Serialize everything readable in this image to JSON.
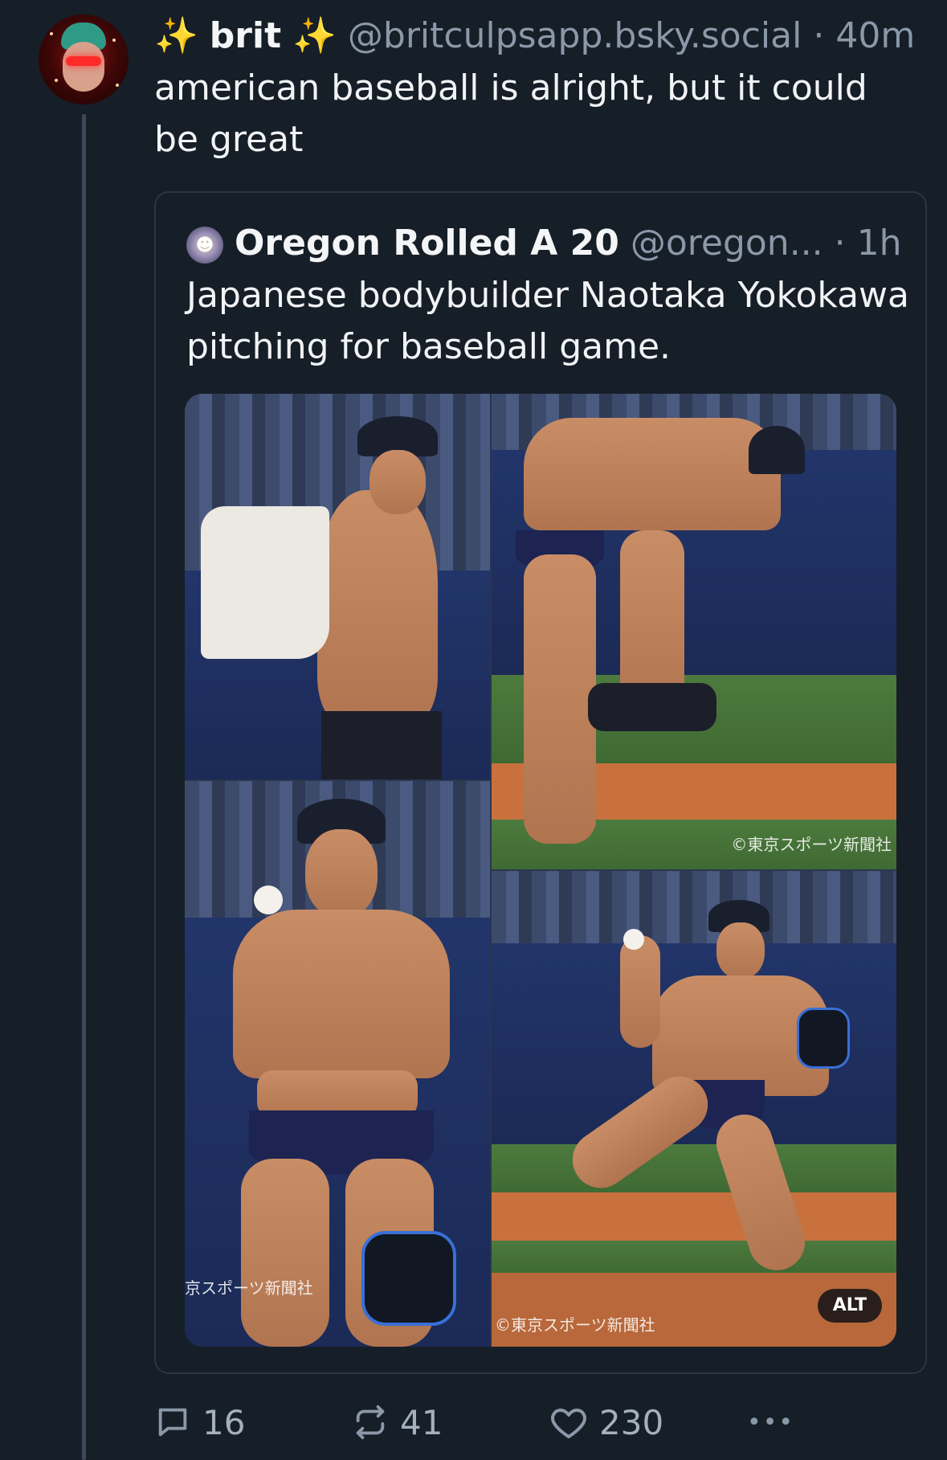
{
  "post": {
    "display_name": "brit",
    "sparkle_left": "✨",
    "sparkle_right": "✨",
    "handle": "@britculpsapp.bsky.social",
    "separator": "·",
    "time": "40m",
    "text": "american baseball is alright, but it could be great"
  },
  "quote": {
    "display_name": "Oregon Rolled A 20",
    "handle": "@oregon...",
    "separator": "·",
    "time": "1h",
    "text": "Japanese bodybuilder Naotaka Yokokawa pitching for baseball game.",
    "media": {
      "watermark_1": "©東京スポーツ新聞社",
      "watermark_2": "京スポーツ新聞社",
      "watermark_3": "©東京スポーツ新聞社",
      "alt_label": "ALT"
    }
  },
  "actions": {
    "reply_count": "16",
    "repost_count": "41",
    "like_count": "230",
    "more_label": "•••"
  },
  "colors": {
    "background": "#161e27",
    "text": "#f1f3f5",
    "muted": "#8a98a8",
    "border": "#2b3644",
    "sparkle": "#f5c542"
  }
}
